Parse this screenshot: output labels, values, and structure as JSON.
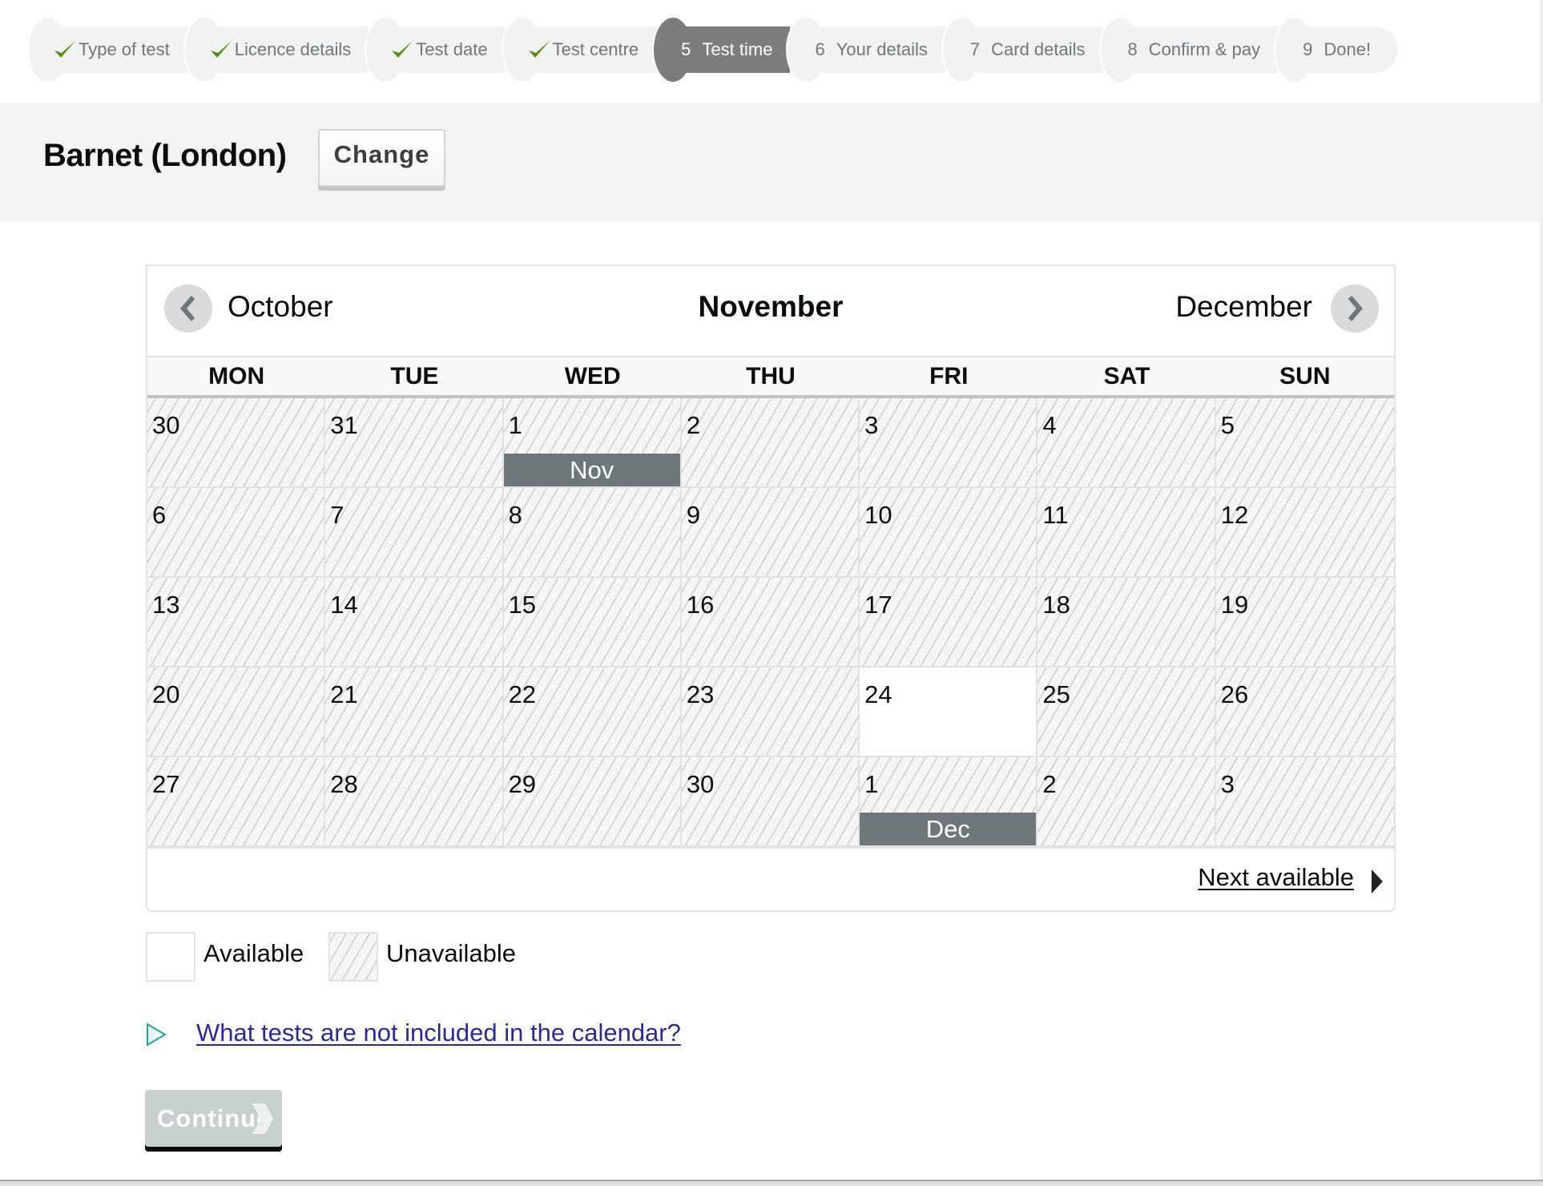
{
  "progress": {
    "steps": [
      {
        "number": "",
        "label": "Type of test",
        "state": "done",
        "icon": "check-icon"
      },
      {
        "number": "",
        "label": "Licence details",
        "state": "done",
        "icon": "check-icon"
      },
      {
        "number": "",
        "label": "Test date",
        "state": "done",
        "icon": "check-icon"
      },
      {
        "number": "",
        "label": "Test centre",
        "state": "done",
        "icon": "check-icon"
      },
      {
        "number": "5",
        "label": "Test time",
        "state": "current"
      },
      {
        "number": "6",
        "label": "Your details",
        "state": "todo"
      },
      {
        "number": "7",
        "label": "Card details",
        "state": "todo"
      },
      {
        "number": "8",
        "label": "Confirm & pay",
        "state": "todo"
      },
      {
        "number": "9",
        "label": "Done!",
        "state": "todo"
      }
    ]
  },
  "location": {
    "centre_name": "Barnet (London)",
    "change_label": "Change"
  },
  "calendar": {
    "prev_month": "October",
    "current_month": "November",
    "next_month": "December",
    "prev_icon": "chevron-left-icon",
    "next_icon": "chevron-right-icon",
    "weekdays": [
      "MON",
      "TUE",
      "WED",
      "THU",
      "FRI",
      "SAT",
      "SUN"
    ],
    "weeks": [
      [
        {
          "day": "30",
          "available": false
        },
        {
          "day": "31",
          "available": false
        },
        {
          "day": "1",
          "available": false,
          "month_label": "Nov"
        },
        {
          "day": "2",
          "available": false
        },
        {
          "day": "3",
          "available": false
        },
        {
          "day": "4",
          "available": false
        },
        {
          "day": "5",
          "available": false
        }
      ],
      [
        {
          "day": "6",
          "available": false
        },
        {
          "day": "7",
          "available": false
        },
        {
          "day": "8",
          "available": false
        },
        {
          "day": "9",
          "available": false
        },
        {
          "day": "10",
          "available": false
        },
        {
          "day": "11",
          "available": false
        },
        {
          "day": "12",
          "available": false
        }
      ],
      [
        {
          "day": "13",
          "available": false
        },
        {
          "day": "14",
          "available": false
        },
        {
          "day": "15",
          "available": false
        },
        {
          "day": "16",
          "available": false
        },
        {
          "day": "17",
          "available": false
        },
        {
          "day": "18",
          "available": false
        },
        {
          "day": "19",
          "available": false
        }
      ],
      [
        {
          "day": "20",
          "available": false
        },
        {
          "day": "21",
          "available": false
        },
        {
          "day": "22",
          "available": false
        },
        {
          "day": "23",
          "available": false
        },
        {
          "day": "24",
          "available": true
        },
        {
          "day": "25",
          "available": false
        },
        {
          "day": "26",
          "available": false
        }
      ],
      [
        {
          "day": "27",
          "available": false
        },
        {
          "day": "28",
          "available": false
        },
        {
          "day": "29",
          "available": false
        },
        {
          "day": "30",
          "available": false
        },
        {
          "day": "1",
          "available": false,
          "month_label": "Dec"
        },
        {
          "day": "2",
          "available": false
        },
        {
          "day": "3",
          "available": false
        }
      ]
    ],
    "next_available_label": "Next available"
  },
  "legend": {
    "available_label": "Available",
    "unavailable_label": "Unavailable"
  },
  "details": {
    "summary_label": "What tests are not included in the calendar?"
  },
  "actions": {
    "continue_label": "Continue",
    "continue_disabled": true
  },
  "colors": {
    "current_step": "#7d7d7d",
    "check": "#5a8a1e",
    "month_marker": "#6f777b",
    "link": "#2b2b8c",
    "details_arrow": "#28a197",
    "continue_disabled_bg": "#c8cfcf"
  }
}
